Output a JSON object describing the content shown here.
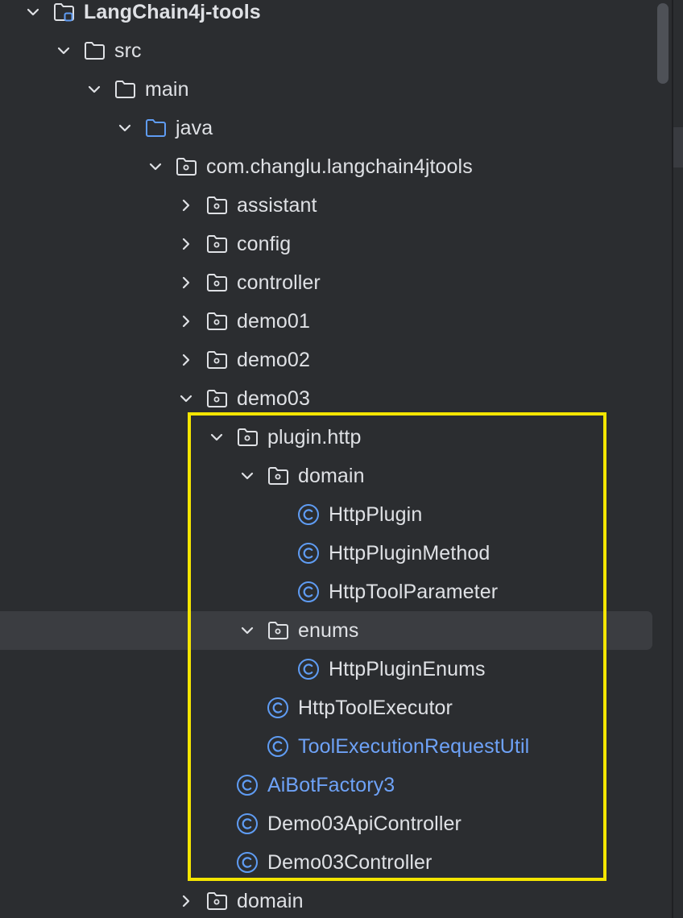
{
  "project_tree": {
    "items": [
      {
        "label": "LangChain4j-tools",
        "depth": 0,
        "expanded": true,
        "icon": "module-folder-icon",
        "bold": true
      },
      {
        "label": "src",
        "depth": 1,
        "expanded": true,
        "icon": "folder-icon"
      },
      {
        "label": "main",
        "depth": 2,
        "expanded": true,
        "icon": "folder-icon"
      },
      {
        "label": "java",
        "depth": 3,
        "expanded": true,
        "icon": "source-root-folder-icon"
      },
      {
        "label": "com.changlu.langchain4jtools",
        "depth": 4,
        "expanded": true,
        "icon": "package-icon"
      },
      {
        "label": "assistant",
        "depth": 5,
        "expanded": false,
        "icon": "package-icon"
      },
      {
        "label": "config",
        "depth": 5,
        "expanded": false,
        "icon": "package-icon"
      },
      {
        "label": "controller",
        "depth": 5,
        "expanded": false,
        "icon": "package-icon"
      },
      {
        "label": "demo01",
        "depth": 5,
        "expanded": false,
        "icon": "package-icon"
      },
      {
        "label": "demo02",
        "depth": 5,
        "expanded": false,
        "icon": "package-icon"
      },
      {
        "label": "demo03",
        "depth": 5,
        "expanded": true,
        "icon": "package-icon"
      },
      {
        "label": "plugin.http",
        "depth": 6,
        "expanded": true,
        "icon": "package-icon"
      },
      {
        "label": "domain",
        "depth": 7,
        "expanded": true,
        "icon": "package-icon"
      },
      {
        "label": "HttpPlugin",
        "depth": 8,
        "icon": "class-icon"
      },
      {
        "label": "HttpPluginMethod",
        "depth": 8,
        "icon": "class-icon"
      },
      {
        "label": "HttpToolParameter",
        "depth": 8,
        "icon": "class-icon"
      },
      {
        "label": "enums",
        "depth": 7,
        "expanded": true,
        "icon": "package-icon",
        "selected": true
      },
      {
        "label": "HttpPluginEnums",
        "depth": 8,
        "icon": "class-icon"
      },
      {
        "label": "HttpToolExecutor",
        "depth": 7,
        "icon": "class-icon"
      },
      {
        "label": "ToolExecutionRequestUtil",
        "depth": 7,
        "icon": "class-icon",
        "modified": true
      },
      {
        "label": "AiBotFactory3",
        "depth": 6,
        "icon": "class-icon",
        "modified": true
      },
      {
        "label": "Demo03ApiController",
        "depth": 6,
        "icon": "class-icon"
      },
      {
        "label": "Demo03Controller",
        "depth": 6,
        "icon": "class-icon"
      },
      {
        "label": "domain",
        "depth": 5,
        "expanded": false,
        "icon": "package-icon"
      }
    ]
  },
  "colors": {
    "background": "#2b2d30",
    "text": "#dfe1e5",
    "modified_text": "#6ea2f7",
    "class_icon": "#5f9cf3",
    "highlight_border": "#f4e500",
    "selection": "#3b3d41"
  }
}
